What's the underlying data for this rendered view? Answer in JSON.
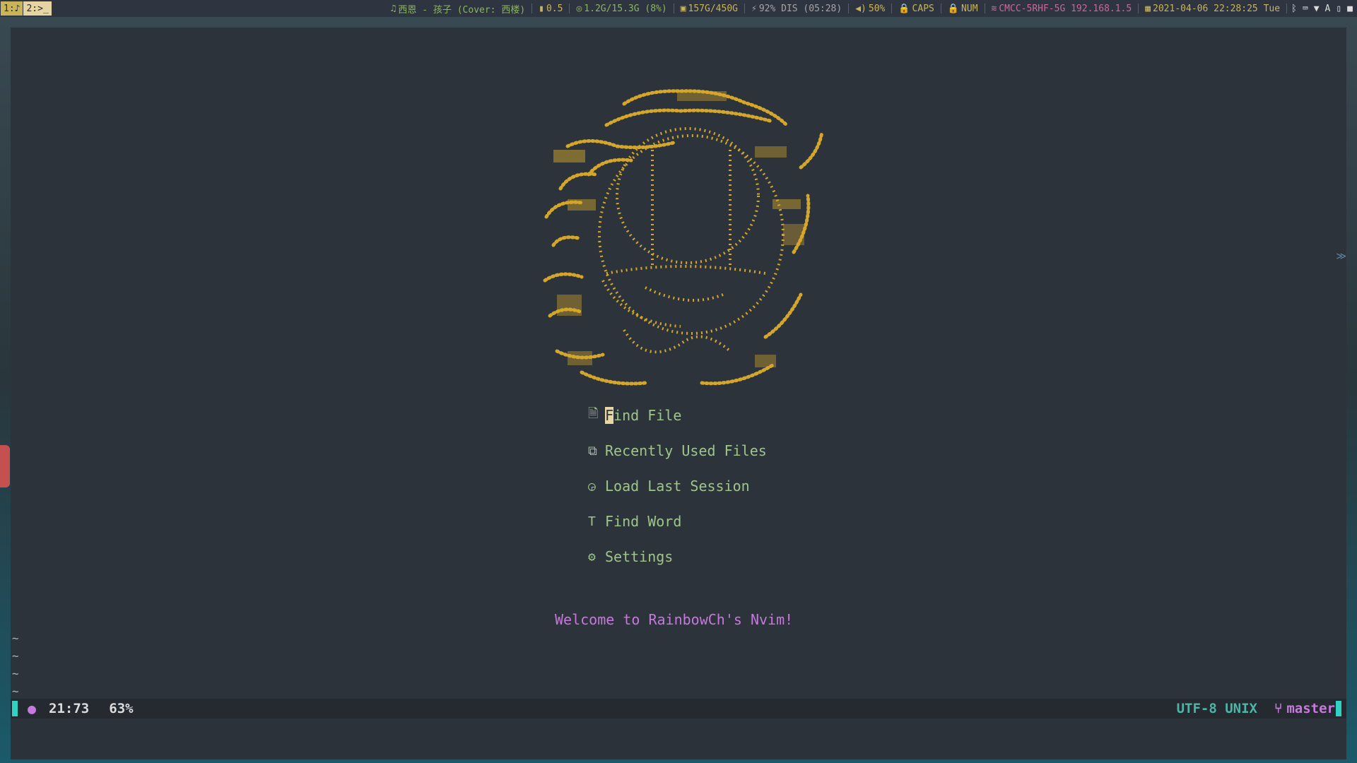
{
  "topbar": {
    "workspaces": [
      {
        "label": "1:♪"
      },
      {
        "label": "2:>_"
      }
    ],
    "music": "西恩 - 孩子 (Cover: 西楼)",
    "load": "0.5",
    "memory": "1.2G/15.3G (8%)",
    "disk": "157G/450G",
    "battery": "92% DIS (05:28)",
    "volume": "50%",
    "caps": "CAPS",
    "num": "NUM",
    "wifi": "CMCC-5RHF-5G 192.168.1.5",
    "datetime": "2021-04-06 22:28:25 Tue"
  },
  "dashboard": {
    "menu": [
      {
        "icon": "file-icon",
        "glyph": "🗎",
        "first": "F",
        "rest": "ind File"
      },
      {
        "icon": "recent-files-icon",
        "glyph": "⧉",
        "label": "Recently Used Files"
      },
      {
        "icon": "session-icon",
        "glyph": "◶",
        "label": "Load Last Session"
      },
      {
        "icon": "text-icon",
        "glyph": "T",
        "label": "Find Word"
      },
      {
        "icon": "gear-icon",
        "glyph": "⚙",
        "label": "Settings"
      }
    ],
    "welcome": "Welcome to RainbowCh's Nvim!"
  },
  "buffer": {
    "tildes": [
      "~",
      "~",
      "~",
      "~"
    ]
  },
  "statusline": {
    "position": "21:73",
    "percent": "63%",
    "encoding": "UTF-8 UNIX",
    "branch_icon": "⑂",
    "branch": "master"
  },
  "colors": {
    "accent_green": "#9fc58a",
    "ascii_art": "#d4a72c",
    "welcome": "#c678dd",
    "mode": "#2ed3c3"
  }
}
